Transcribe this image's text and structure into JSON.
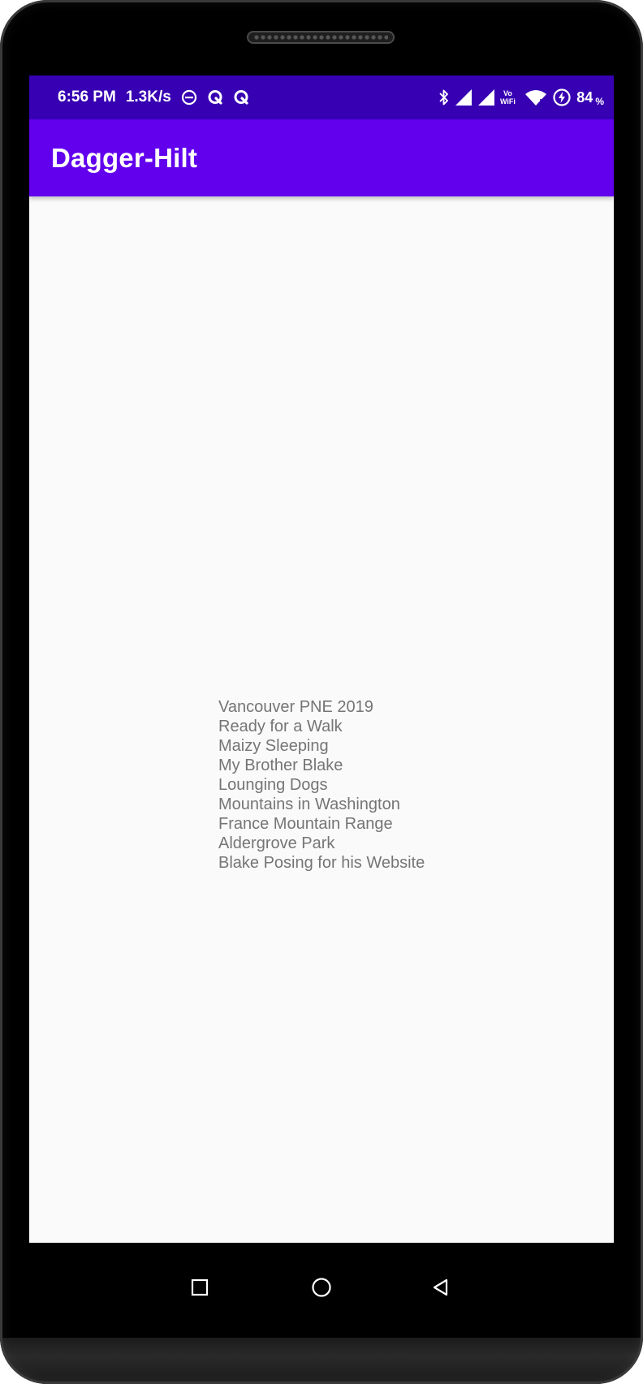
{
  "status_bar": {
    "time": "6:56 PM",
    "net_speed": "1.3K/s",
    "vowifi_top": "Vo",
    "vowifi_bottom": "WiFi",
    "battery_level": "84",
    "battery_unit": "%",
    "left_icons": [
      "do-not-disturb-icon",
      "q-app-icon",
      "q-app-icon"
    ],
    "right_icons": [
      "bluetooth-icon",
      "signal-icon",
      "signal-icon",
      "vowifi-icon",
      "wifi-icon",
      "battery-charging-icon"
    ]
  },
  "app_bar": {
    "title": "Dagger-Hilt"
  },
  "photo_list": {
    "items": [
      "Vancouver PNE 2019",
      "Ready for a Walk",
      "Maizy Sleeping",
      "My Brother Blake",
      "Lounging Dogs",
      "Mountains in Washington",
      "France Mountain Range",
      "Aldergrove Park",
      "Blake Posing for his Website"
    ]
  },
  "nav_bar": {
    "buttons": [
      "recents-square-icon",
      "home-circle-icon",
      "back-triangle-icon"
    ]
  },
  "colors": {
    "status_bar": "#3700b3",
    "app_bar": "#6200ee",
    "background": "#fafafa",
    "list_text": "#757575"
  }
}
